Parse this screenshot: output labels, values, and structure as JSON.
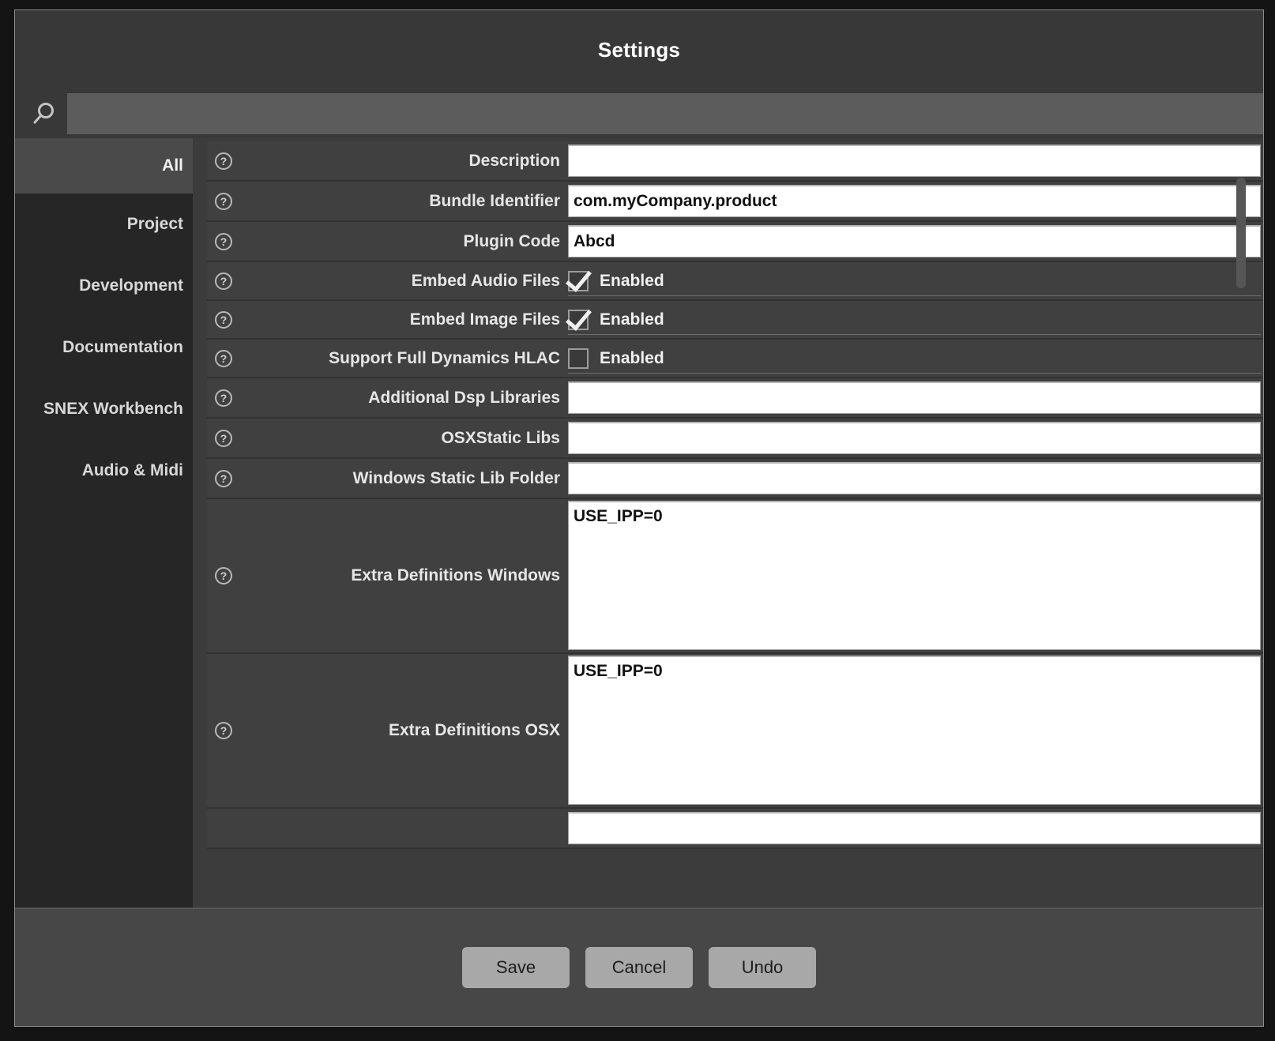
{
  "window": {
    "title": "Settings"
  },
  "search": {
    "icon": "search-icon",
    "value": "",
    "placeholder": ""
  },
  "sidebar": {
    "items": [
      {
        "label": "All",
        "selected": true
      },
      {
        "label": "Project",
        "selected": false
      },
      {
        "label": "Development",
        "selected": false
      },
      {
        "label": "Documentation",
        "selected": false
      },
      {
        "label": "SNEX Workbench",
        "selected": false
      },
      {
        "label": "Audio & Midi",
        "selected": false
      }
    ]
  },
  "settings": {
    "help_glyph": "?",
    "rows": [
      {
        "label": "Description",
        "type": "text",
        "value": ""
      },
      {
        "label": "Bundle Identifier",
        "type": "text",
        "value": "com.myCompany.product"
      },
      {
        "label": "Plugin Code",
        "type": "text",
        "value": "Abcd"
      },
      {
        "label": "Embed Audio Files",
        "type": "checkbox",
        "value": "Enabled",
        "checked": true
      },
      {
        "label": "Embed Image Files",
        "type": "checkbox",
        "value": "Enabled",
        "checked": true
      },
      {
        "label": "Support Full Dynamics HLAC",
        "type": "checkbox",
        "value": "Enabled",
        "checked": false
      },
      {
        "label": "Additional Dsp Libraries",
        "type": "text",
        "value": ""
      },
      {
        "label": "OSXStatic Libs",
        "type": "text",
        "value": ""
      },
      {
        "label": "Windows Static Lib Folder",
        "type": "text",
        "value": ""
      },
      {
        "label": "Extra Definitions Windows",
        "type": "textarea",
        "value": "USE_IPP=0"
      },
      {
        "label": "Extra Definitions OSX",
        "type": "textarea",
        "value": "USE_IPP=0"
      },
      {
        "label": "",
        "type": "text",
        "value": ""
      }
    ]
  },
  "footer": {
    "buttons": [
      {
        "label": "Save"
      },
      {
        "label": "Cancel"
      },
      {
        "label": "Undo"
      }
    ]
  },
  "colors": {
    "window_bg": "#383838",
    "sidebar_bg": "#262626",
    "sidebar_selected": "#4a4a4a",
    "row_bg": "#404040",
    "input_bg": "#ffffff",
    "button_bg": "#a8a8a8",
    "accent_green": "#4e8c4e"
  }
}
